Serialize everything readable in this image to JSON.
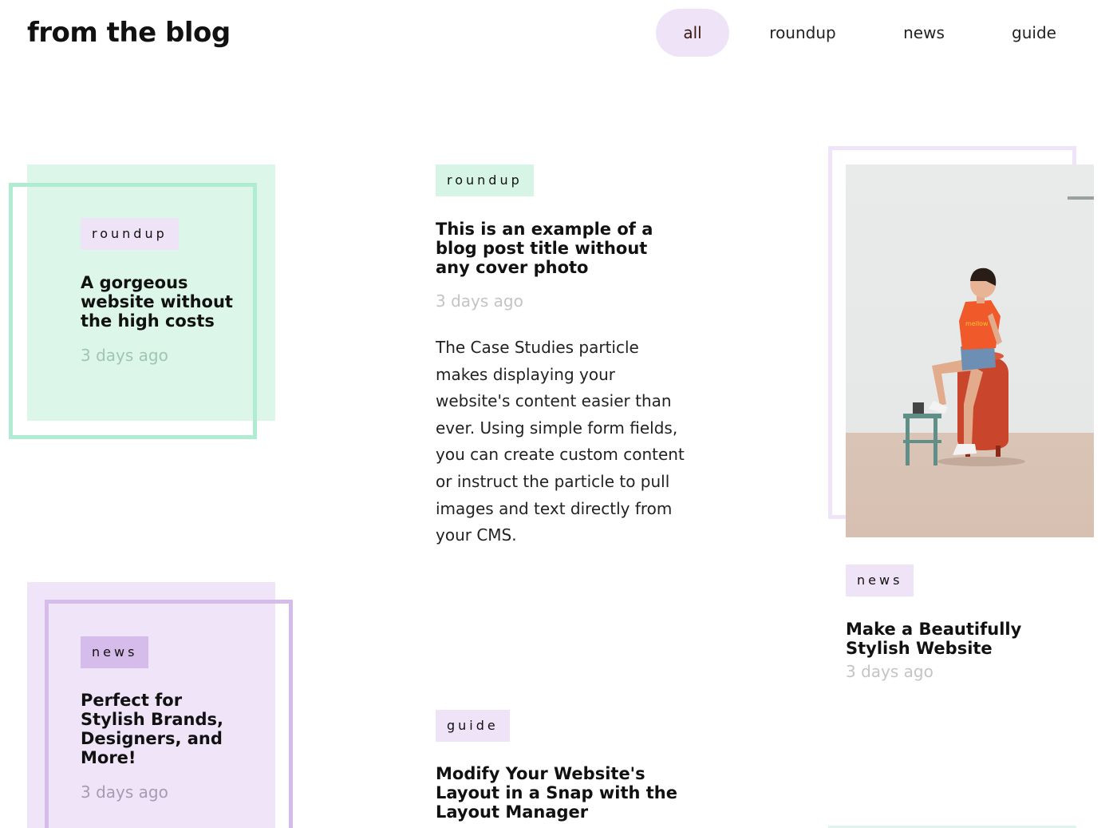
{
  "header": {
    "title": "from the blog",
    "filters": [
      {
        "label": "all",
        "active": true
      },
      {
        "label": "roundup",
        "active": false
      },
      {
        "label": "news",
        "active": false
      },
      {
        "label": "guide",
        "active": false
      }
    ]
  },
  "posts": [
    {
      "tag": "roundup",
      "title": "A gorgeous website without the high costs",
      "date": "3 days ago"
    },
    {
      "tag": "roundup",
      "title": "This is an example of a blog post title without any cover photo",
      "date": "3 days ago",
      "excerpt": "The Case Studies particle makes displaying your website's content easier than ever. Using simple form fields, you can create custom content or instruct the particle to pull images and text directly from your CMS."
    },
    {
      "tag": "news",
      "title": "Make a Beautifully Stylish Website",
      "date": "3 days ago",
      "image": "woman-sitting-on-red-tank-photo"
    },
    {
      "tag": "news",
      "title": "Perfect for Stylish Brands, Designers, and More!",
      "date": "3 days ago"
    },
    {
      "tag": "guide",
      "title": "Modify Your Website's Layout in a Snap with the Layout Manager",
      "date": ""
    }
  ],
  "colors": {
    "mint_bg": "#dcf6e9",
    "mint_frame": "#b0ecd2",
    "lavender_bg": "#efe4f8",
    "lavender_frame": "#d5bcea",
    "tag_lavender": "#eee3f7",
    "tag_mint": "#d7f5e6",
    "tag_purple": "#d5bcea",
    "photo_frame": "#efe4f8",
    "date_gray": "#bbbbbb"
  }
}
